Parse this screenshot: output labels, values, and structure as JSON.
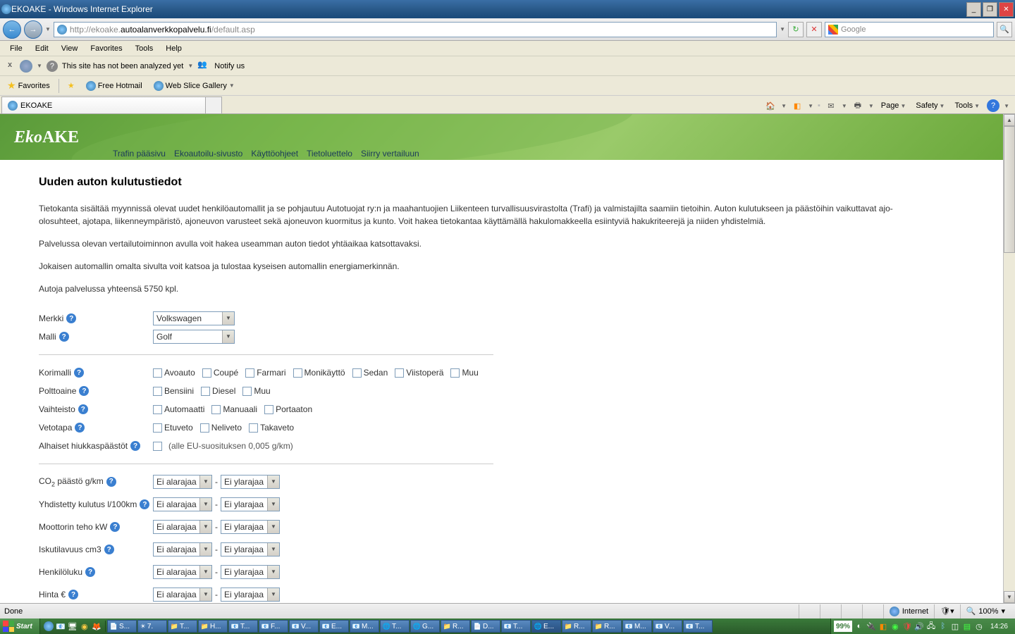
{
  "window": {
    "title": "EKOAKE - Windows Internet Explorer",
    "min": "_",
    "max": "❐",
    "close": "✕"
  },
  "nav": {
    "back": "←",
    "fwd": "→",
    "url_prefix": "http://ekoake.",
    "url_domain": "autoalanverkkopalvelu.fi",
    "url_suffix": "/default.asp",
    "refresh": "↻",
    "stop": "✕",
    "search_engine": "Google",
    "search_glass": "🔍"
  },
  "menu": {
    "file": "File",
    "edit": "Edit",
    "view": "View",
    "favorites": "Favorites",
    "tools": "Tools",
    "help": "Help"
  },
  "infobar": {
    "close": "x",
    "msg": "This site has not been analyzed yet",
    "notify": "Notify us"
  },
  "favbar": {
    "favorites": "Favorites",
    "hotmail": "Free Hotmail",
    "webslice": "Web Slice Gallery"
  },
  "tabs": {
    "tab1": "EKOAKE"
  },
  "tabright": {
    "page": "Page",
    "safety": "Safety",
    "tools": "Tools"
  },
  "header": {
    "logo_a": "Eko",
    "logo_b": "AKE",
    "nav": [
      "Trafin pääsivu",
      "Ekoautoilu-sivusto",
      "Käyttöohjeet",
      "Tietoluettelo",
      "Siirry vertailuun"
    ]
  },
  "page": {
    "h1": "Uuden auton kulutustiedot",
    "p1": "Tietokanta sisältää myynnissä olevat uudet henkilöautomallit ja se pohjautuu Autotuojat ry:n ja maahantuojien Liikenteen turvallisuusvirastolta (Trafi) ja valmistajilta saamiin tietoihin. Auton kulutukseen ja päästöihin vaikuttavat ajo-olosuhteet, ajotapa, liikenneympäristö, ajoneuvon varusteet sekä ajoneuvon kuormitus ja kunto. Voit hakea tietokantaa käyttämällä hakulomakkeella esiintyviä hakukriteerejä ja niiden yhdistelmiä.",
    "p2": "Palvelussa olevan vertailutoiminnon avulla voit hakea useamman auton tiedot yhtäaikaa katsottavaksi.",
    "p3": "Jokaisen automallin omalta sivulta voit katsoa ja tulostaa kyseisen automallin energiamerkinnän.",
    "p4": "Autoja palvelussa yhteensä 5750 kpl."
  },
  "form": {
    "merkki": {
      "label": "Merkki",
      "value": "Volkswagen"
    },
    "malli": {
      "label": "Malli",
      "value": "Golf"
    },
    "korimalli": {
      "label": "Korimalli",
      "opts": [
        "Avoauto",
        "Coupé",
        "Farmari",
        "Monikäyttö",
        "Sedan",
        "Viistoperä",
        "Muu"
      ]
    },
    "polttoaine": {
      "label": "Polttoaine",
      "opts": [
        "Bensiini",
        "Diesel",
        "Muu"
      ]
    },
    "vaihteisto": {
      "label": "Vaihteisto",
      "opts": [
        "Automaatti",
        "Manuaali",
        "Portaaton"
      ]
    },
    "vetotapa": {
      "label": "Vetotapa",
      "opts": [
        "Etuveto",
        "Neliveto",
        "Takaveto"
      ]
    },
    "hiukkas": {
      "label": "Alhaiset hiukkaspäästöt",
      "note": "(alle EU-suosituksen 0,005 g/km)"
    },
    "ranges": [
      {
        "label": "CO",
        "sub": "2",
        "suffix": " päästö g/km"
      },
      {
        "label": "Yhdistetty kulutus l/100km",
        "sub": "",
        "suffix": ""
      },
      {
        "label": "Moottorin teho kW",
        "sub": "",
        "suffix": ""
      },
      {
        "label": "Iskutilavuus cm3",
        "sub": "",
        "suffix": ""
      },
      {
        "label": "Henkilöluku",
        "sub": "",
        "suffix": ""
      },
      {
        "label": "Hinta €",
        "sub": "",
        "suffix": ""
      }
    ],
    "lo": "Ei alarajaa",
    "hi": "Ei ylarajaa",
    "dash": "-",
    "help": "?"
  },
  "status": {
    "left": "Done",
    "internet": "Internet",
    "zoom": "100%"
  },
  "taskbar": {
    "start": "Start",
    "tasks": [
      "S...",
      "7.",
      "T...",
      "H...",
      "T...",
      "F...",
      "V...",
      "E...",
      "M...",
      "T...",
      "G...",
      "R...",
      "D...",
      "T...",
      "E...",
      "R...",
      "R...",
      "M...",
      "V...",
      "T..."
    ],
    "cpu": "99%",
    "clock": "14:26"
  }
}
